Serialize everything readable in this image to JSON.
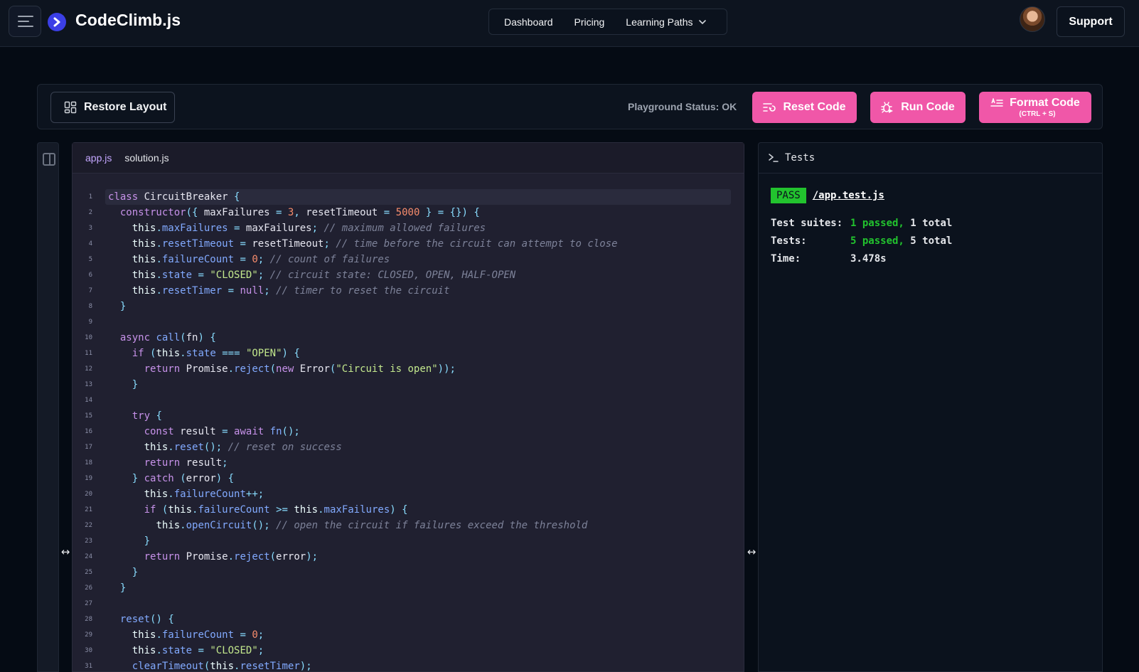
{
  "header": {
    "brand": "CodeClimb.js",
    "nav": [
      "Dashboard",
      "Pricing",
      "Learning Paths"
    ],
    "support_label": "Support"
  },
  "toolbar": {
    "restore_label": "Restore Layout",
    "status": "Playground Status: OK",
    "reset_label": "Reset Code",
    "run_label": "Run Code",
    "format_label": "Format Code",
    "format_shortcut": "(CTRL + S)"
  },
  "editor": {
    "tabs": [
      "app.js",
      "solution.js"
    ],
    "active_tab": "app.js",
    "lines": [
      "class CircuitBreaker {",
      "  constructor({ maxFailures = 3, resetTimeout = 5000 } = {}) {",
      "    this.maxFailures = maxFailures; // maximum allowed failures",
      "    this.resetTimeout = resetTimeout; // time before the circuit can attempt to close",
      "    this.failureCount = 0; // count of failures",
      "    this.state = \"CLOSED\"; // circuit state: CLOSED, OPEN, HALF-OPEN",
      "    this.resetTimer = null; // timer to reset the circuit",
      "  }",
      "",
      "  async call(fn) {",
      "    if (this.state === \"OPEN\") {",
      "      return Promise.reject(new Error(\"Circuit is open\"));",
      "    }",
      "",
      "    try {",
      "      const result = await fn();",
      "      this.reset(); // reset on success",
      "      return result;",
      "    } catch (error) {",
      "      this.failureCount++;",
      "      if (this.failureCount >= this.maxFailures) {",
      "        this.openCircuit(); // open the circuit if failures exceed the threshold",
      "      }",
      "      return Promise.reject(error);",
      "    }",
      "  }",
      "",
      "  reset() {",
      "    this.failureCount = 0;",
      "    this.state = \"CLOSED\";",
      "    clearTimeout(this.resetTimer);"
    ]
  },
  "tests": {
    "title": "Tests",
    "badge": "PASS",
    "file": "/app.test.js",
    "suites_label": "Test suites:",
    "suites_passed": "1 passed,",
    "suites_total": "1 total",
    "tests_label": "Tests:",
    "tests_passed": "5 passed,",
    "tests_total": "5 total",
    "time_label": "Time:",
    "time_value": "3.478s"
  },
  "colors": {
    "accent_pink": "#f057a8",
    "pass_green": "#22c32e",
    "brand_blue": "#3b3fe6"
  },
  "icons": [
    "menu-icon",
    "brand-logo-icon",
    "chevron-down-icon",
    "layout-grid-icon",
    "reset-list-icon",
    "bug-play-icon",
    "format-text-icon",
    "sidebar-toggle-icon",
    "terminal-icon",
    "resize-handle-icon"
  ]
}
